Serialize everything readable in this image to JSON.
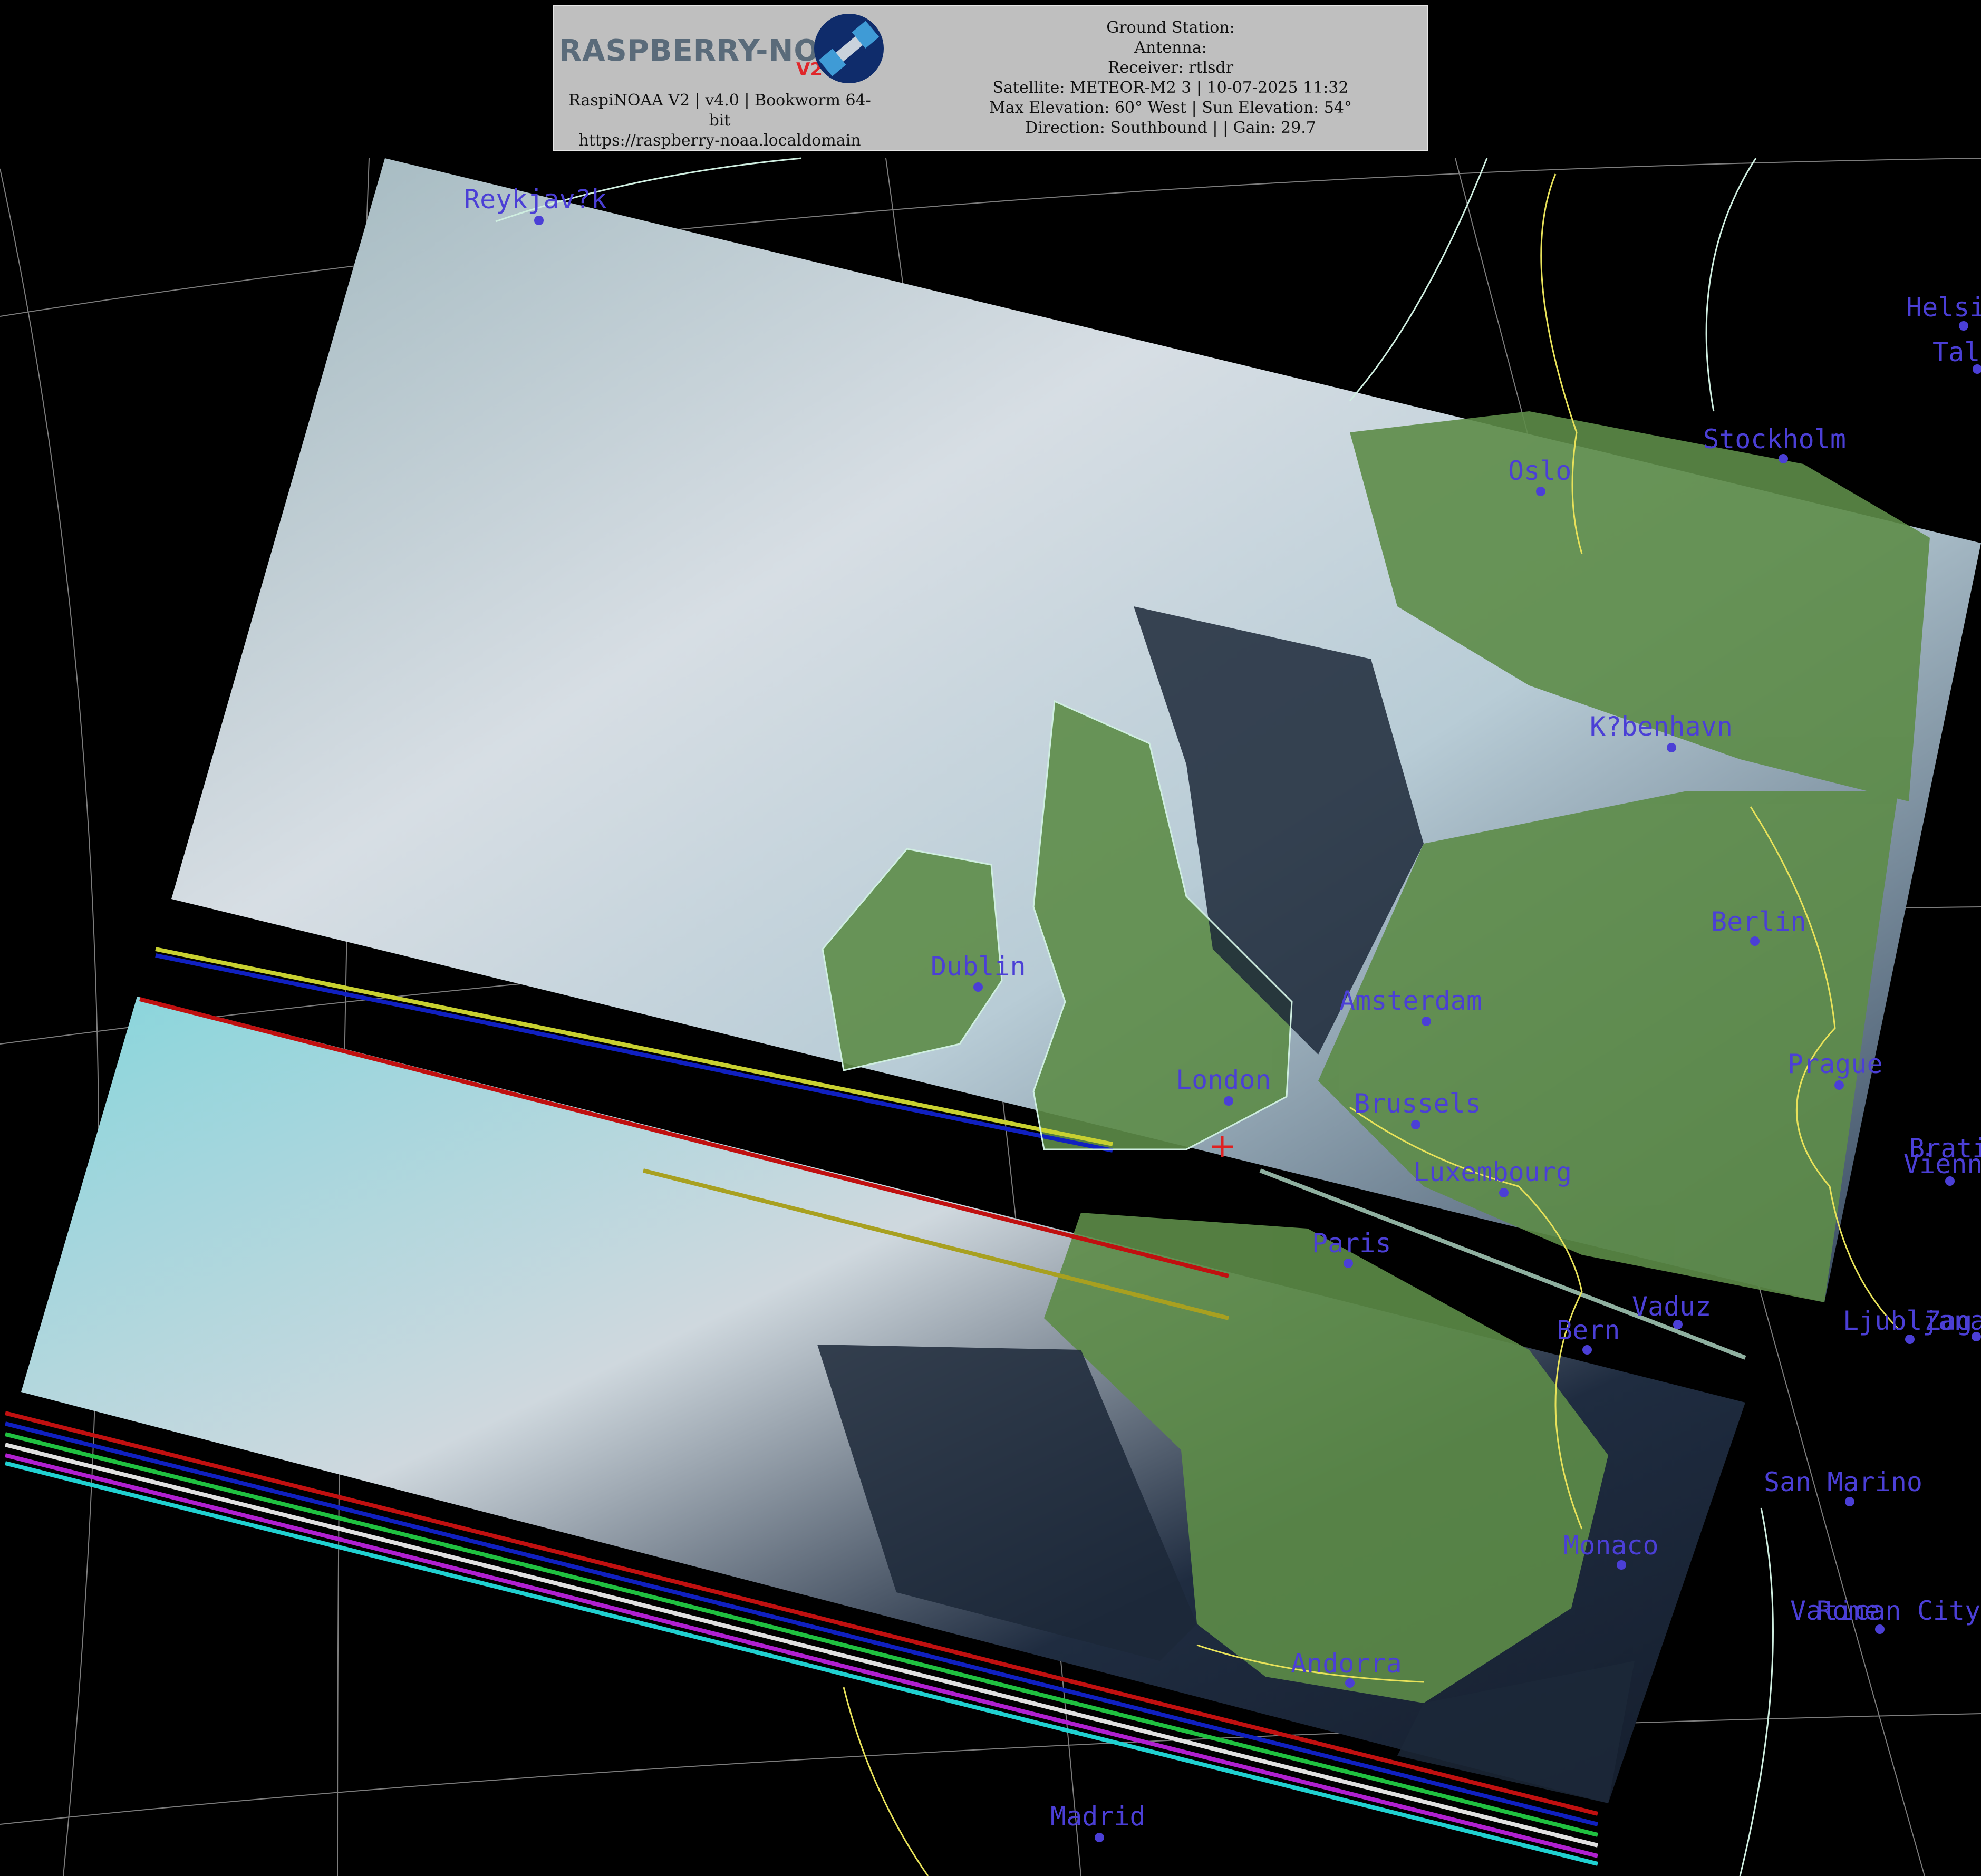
{
  "header": {
    "logo_text": "RASPBERRY-NOAA",
    "logo_version": "V2",
    "logo_icon": "satellite-icon",
    "software_line1": "RaspiNOAA V2 | v4.0 | Bookworm 64-",
    "software_line2": "bit",
    "url": "https://raspberry-noaa.localdomain",
    "ground_station": "Ground Station:",
    "antenna": "Antenna:",
    "receiver": "Receiver: rtlsdr",
    "satellite": "Satellite: METEOR-M2 3 | 10-07-2025 11:32",
    "elevation": "Max Elevation: 60° West | Sun Elevation: 54°",
    "direction": "Direction: Southbound | | Gain: 29.7"
  },
  "colors": {
    "city": "#4b3fd6",
    "coastline": "#cfeee0",
    "border": "#e8e25a",
    "graticule": "#8a8a8a",
    "marker": "#e02020"
  },
  "cities": [
    {
      "name": "Reykjav?k"
    },
    {
      "name": "Helsi"
    },
    {
      "name": "Tall"
    },
    {
      "name": "Stockholm"
    },
    {
      "name": "Oslo"
    },
    {
      "name": "K?benhavn"
    },
    {
      "name": "Berlin"
    },
    {
      "name": "Dublin"
    },
    {
      "name": "Amsterdam"
    },
    {
      "name": "London"
    },
    {
      "name": "Brussels"
    },
    {
      "name": "Prague"
    },
    {
      "name": "Luxembourg"
    },
    {
      "name": "Vienn"
    },
    {
      "name": "Bratis"
    },
    {
      "name": "Paris"
    },
    {
      "name": "Vaduz"
    },
    {
      "name": "Bern"
    },
    {
      "name": "Ljubljana"
    },
    {
      "name": "Zag"
    },
    {
      "name": "San Marino"
    },
    {
      "name": "Monaco"
    },
    {
      "name": "Vatican City"
    },
    {
      "name": "Rome"
    },
    {
      "name": "Andorra"
    },
    {
      "name": "Madrid"
    }
  ]
}
